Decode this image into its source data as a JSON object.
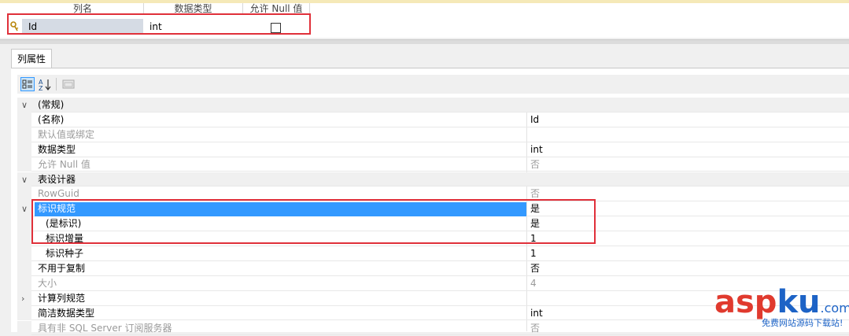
{
  "columns_grid": {
    "headers": [
      "列名",
      "数据类型",
      "允许 Null 值"
    ],
    "row": {
      "name": "Id",
      "type": "int",
      "allow_null": false
    }
  },
  "tab_label": "列属性",
  "properties": [
    {
      "kind": "category",
      "label": "(常规)",
      "expanded": true
    },
    {
      "kind": "prop",
      "label": "(名称)",
      "value": "Id"
    },
    {
      "kind": "prop",
      "label": "默认值或绑定",
      "value": "",
      "disabled": true
    },
    {
      "kind": "prop",
      "label": "数据类型",
      "value": "int"
    },
    {
      "kind": "prop",
      "label": "允许 Null 值",
      "value": "否",
      "disabled": true
    },
    {
      "kind": "category",
      "label": "表设计器",
      "expanded": true
    },
    {
      "kind": "prop",
      "label": "RowGuid",
      "value": "否",
      "disabled": true
    },
    {
      "kind": "prop",
      "label": "标识规范",
      "value": "是",
      "selected": true,
      "expanded": true
    },
    {
      "kind": "sub",
      "label": "(是标识)",
      "value": "是"
    },
    {
      "kind": "sub",
      "label": "标识增量",
      "value": "1"
    },
    {
      "kind": "sub",
      "label": "标识种子",
      "value": "1"
    },
    {
      "kind": "prop",
      "label": "不用于复制",
      "value": "否"
    },
    {
      "kind": "prop",
      "label": "大小",
      "value": "4",
      "disabled": true
    },
    {
      "kind": "prop",
      "label": "计算列规范",
      "value": "",
      "collapsed": true
    },
    {
      "kind": "prop",
      "label": "简洁数据类型",
      "value": "int"
    },
    {
      "kind": "prop",
      "label": "具有非 SQL Server 订阅服务器",
      "value": "否",
      "disabled": true
    }
  ],
  "watermark": {
    "brand_a": "asp",
    "brand_b": "ku",
    "brand_c": ".com",
    "tagline": "免费网站源码下载站!"
  },
  "colors": {
    "selection": "#3399ff",
    "highlight_box": "#e0303a",
    "key_icon": "#d4a017"
  }
}
